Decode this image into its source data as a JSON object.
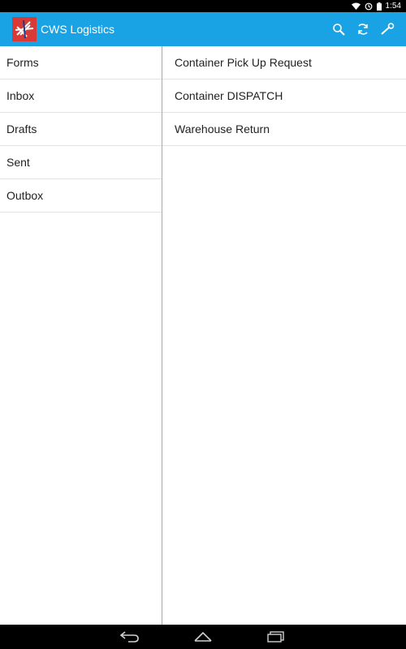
{
  "status_bar": {
    "time": "1:54",
    "icons": [
      "wifi-icon",
      "sync-icon",
      "battery-icon"
    ]
  },
  "action_bar": {
    "title": "CWS Logistics",
    "logo_icon": "cws-logo-icon",
    "actions": [
      {
        "name": "search",
        "icon": "search-icon"
      },
      {
        "name": "refresh",
        "icon": "refresh-icon"
      },
      {
        "name": "settings",
        "icon": "wrench-icon"
      }
    ],
    "background_color": "#1aa3e4"
  },
  "sidebar": {
    "items": [
      {
        "label": "Forms"
      },
      {
        "label": "Inbox"
      },
      {
        "label": "Drafts"
      },
      {
        "label": "Sent"
      },
      {
        "label": "Outbox"
      }
    ]
  },
  "forms_list": {
    "items": [
      {
        "label": "Container Pick Up Request"
      },
      {
        "label": "Container DISPATCH"
      },
      {
        "label": "Warehouse Return"
      }
    ]
  },
  "navigation_bar": {
    "buttons": [
      "back-icon",
      "home-icon",
      "recent-apps-icon"
    ]
  }
}
